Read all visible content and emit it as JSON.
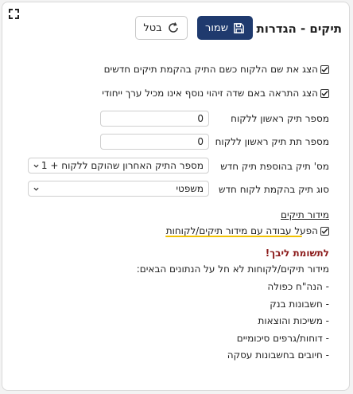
{
  "header": {
    "title": "תיקים - הגדרות",
    "save_label": "שמור",
    "cancel_label": "בטל"
  },
  "options": {
    "show_client_name_as_file": "הצג את שם הלקוח כשם התיק בהקמת תיקים חדשים",
    "warn_nonunique_id": "הצג התראה באם שדה זיהוי נוסף אינו מכיל ערך ייחודי"
  },
  "fields": {
    "first_file_label": "מספר תיק ראשון ללקוח",
    "first_file_value": "0",
    "first_subfile_label": "מספר תת תיק ראשון ללקוח",
    "first_subfile_value": "0",
    "file_no_label": "מס' תיק בהוספת תיק חדש",
    "file_no_value": "מספר התיק האחרון שהוקם ללקוח + 1",
    "file_type_label": "סוג תיק בהקמת לקוח חדש",
    "file_type_value": "משפטי"
  },
  "tagging": {
    "section_title": "מידור תיקים",
    "enable_label": "הפעל עבודה עם מידור תיקים/לקוחות"
  },
  "note": {
    "title": "לתשומת ליבך!",
    "intro": "מידור תיקים/לקוחות לא חל על הנתונים הבאים:",
    "items": [
      "- הנה\"ח כפולה",
      "- חשבונות בנק",
      "- משיכות והוצאות",
      "- דוחות/גרפים סיכומיים",
      "- חיובים בחשבונות עסקה"
    ]
  },
  "colors": {
    "primary": "#1f3a6e",
    "note_title": "#8b1a1a",
    "highlight": "#f2c100"
  }
}
